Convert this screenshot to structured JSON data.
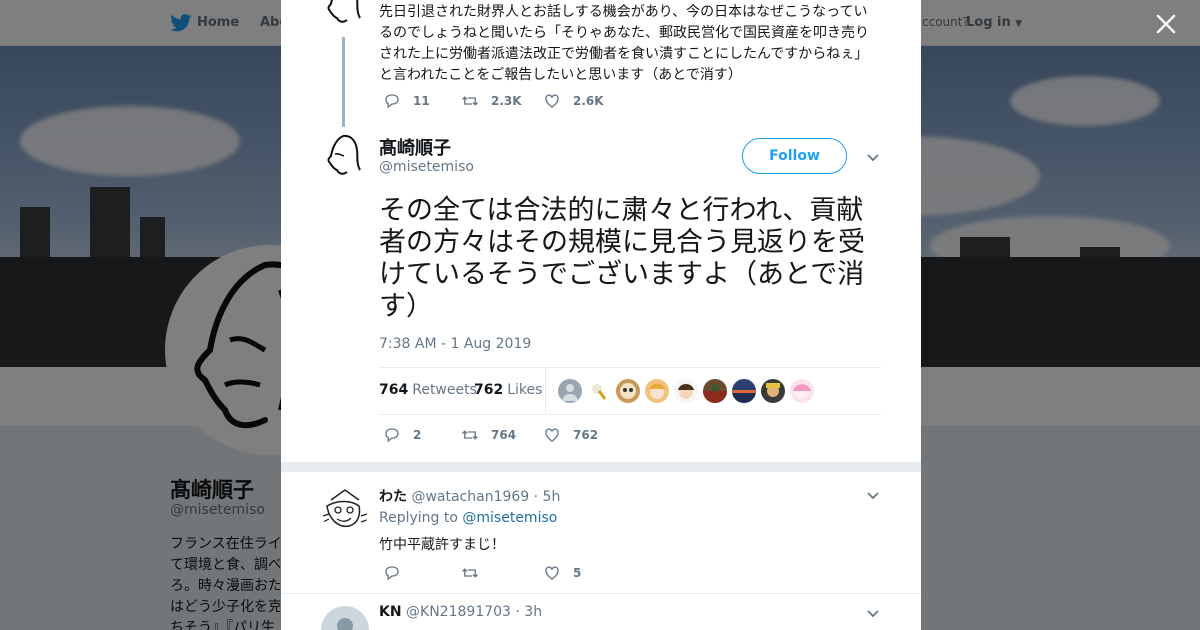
{
  "topbar": {
    "home_label": "Home",
    "about_label": "Abo",
    "account_text": "ccount?",
    "login_label": "Log in"
  },
  "profile": {
    "name": "髙崎順子",
    "handle": "@misetemiso",
    "bio": "フランス在住ライ\nて環境と食、調べ\nろ。時々漫画おた\nはどう少子化を克\nちそう』『パリ生"
  },
  "parent_tweet": {
    "text": "先日引退された財界人とお話しする機会があり、今の日本はなぜこうなっているのでしょうねと聞いたら「そりゃあなた、郵政民営化で国民資産を叩き売りされた上に労働者派遣法改正で労働者を食い潰すことにしたんですからねぇ」と言われたことをご報告したいと思います（あとで消す）",
    "replies": "11",
    "retweets": "2.3K",
    "likes": "2.6K"
  },
  "main_tweet": {
    "name": "髙崎順子",
    "handle": "@misetemiso",
    "follow_label": "Follow",
    "text": "その全ては合法的に粛々と行われ、貢献者の方々はその規模に見合う見返りを受けているそうでございますよ（あとで消す）",
    "timestamp": "7:38 AM - 1 Aug 2019",
    "retweet_count": "764",
    "retweet_label": "Retweets",
    "like_count": "762",
    "like_label": "Likes",
    "replies": "2",
    "retweets": "764",
    "likes": "762"
  },
  "reply1": {
    "name": "わた",
    "handle": "@watachan1969",
    "time": "· 5h",
    "replying_prefix": "Replying to",
    "replying_to": "@misetemiso",
    "text": "竹中平蔵許すまじ！",
    "likes": "5"
  },
  "reply2": {
    "name": "KN",
    "handle": "@KN21891703",
    "time": "· 3h"
  },
  "colors": {
    "accent": "#1da1f2",
    "link": "#1b6fa7",
    "muted": "#657786",
    "thread_line": "#9ab3c0"
  },
  "icons": [
    "twitter-bird-icon",
    "close-icon",
    "reply-icon",
    "retweet-icon",
    "like-icon",
    "chevron-down-icon"
  ]
}
